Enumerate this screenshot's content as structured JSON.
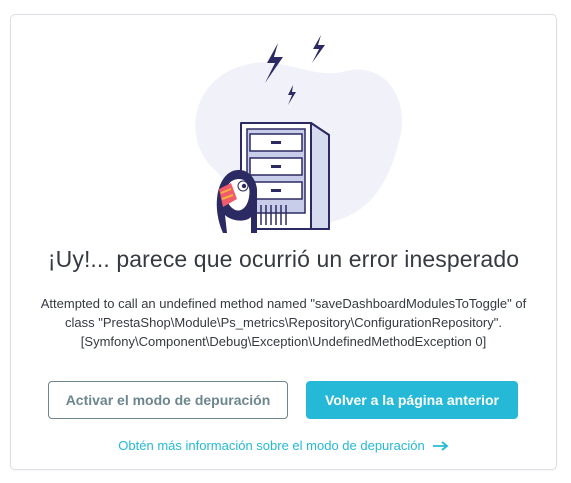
{
  "error": {
    "title": "¡Uy!... parece que ocurrió un error inesperado",
    "message_line1": "Attempted to call an undefined method named \"saveDashboardModulesToToggle\" of",
    "message_line2": "class \"PrestaShop\\Module\\Ps_metrics\\Repository\\ConfigurationRepository\".",
    "message_line3": "[Symfony\\Component\\Debug\\Exception\\UndefinedMethodException 0]"
  },
  "actions": {
    "debug_button_label": "Activar el modo de depuración",
    "back_button_label": "Volver a la página anterior",
    "more_info_link": "Obtén más información sobre el modo de depuración"
  },
  "icons": {
    "illustration": "server-with-puffin-illustration",
    "arrow": "arrow-right-icon"
  },
  "colors": {
    "accent": "#25b9d7",
    "outline": "#6c868e",
    "text": "#363a41",
    "blob": "#f1f1fa",
    "lightning": "#2c2a62"
  }
}
